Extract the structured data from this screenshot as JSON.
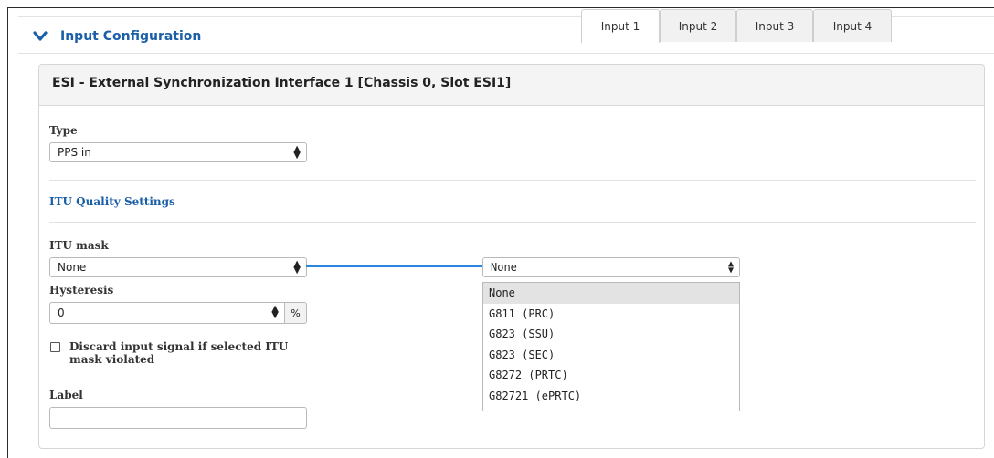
{
  "section": {
    "title": "Input Configuration",
    "icon": "chevron-down-icon",
    "color": "#1b5fa8"
  },
  "panel": {
    "title": "ESI - External Synchronization Interface 1 [Chassis 0, Slot ESI1]",
    "tabs": [
      "Input 1",
      "Input 2",
      "Input 3",
      "Input 4"
    ],
    "active_tab": "Input 1"
  },
  "type": {
    "label": "Type",
    "value": "PPS in"
  },
  "itu_quality": {
    "heading": "ITU Quality Settings"
  },
  "itu_mask": {
    "label": "ITU mask",
    "value": "None",
    "popup_value": "None",
    "options": [
      "None",
      "G811 (PRC)",
      "G823 (SSU)",
      "G823 (SEC)",
      "G8272 (PRTC)",
      "G82721 (ePRTC)"
    ],
    "selected_option": "None"
  },
  "hysteresis": {
    "label": "Hysteresis",
    "value": "0",
    "unit": "%"
  },
  "discard": {
    "label_line1": "Discard input signal if selected ITU",
    "label_line2": "mask violated",
    "checked": false
  },
  "label_field": {
    "label": "Label",
    "value": ""
  },
  "colors": {
    "accent": "#1b5fa8",
    "connector": "#2a86e0"
  }
}
